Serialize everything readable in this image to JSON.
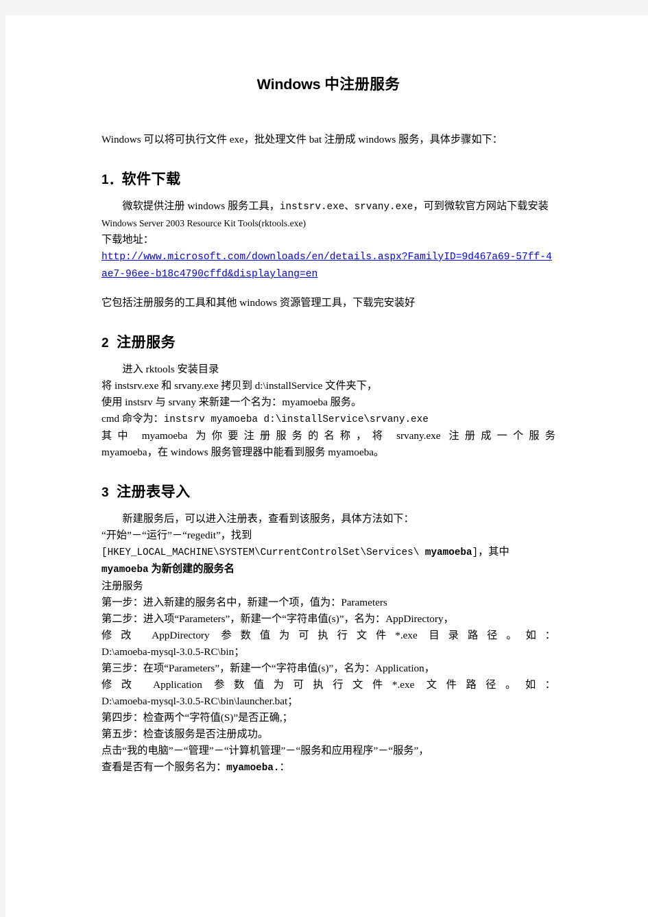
{
  "document": {
    "title_latin": "Windows",
    "title_cjk": " 中注册服务",
    "intro": "Windows 可以将可执行文件 exe，批处理文件 bat 注册成 windows 服务，具体步骤如下："
  },
  "section1": {
    "number": "1．",
    "heading": "软件下载",
    "para1_a": "微软提供注册 windows 服务工具，",
    "para1_mono": "instsrv.exe、srvany.exe",
    "para1_b": "，可到微软官方网站下载安装 ",
    "para1_small": "Windows Server 2003 Resource Kit Tools(rktools.exe)",
    "download_label": "下载地址：",
    "url": "http://www.microsoft.com/downloads/en/details.aspx?FamilyID=9d467a69-57ff-4ae7-96ee-b18c4790cffd&displaylang=en",
    "para2": "它包括注册服务的工具和其他 windows 资源管理工具，下载完安装好"
  },
  "section2": {
    "number": "2",
    "heading": "注册服务",
    "line1": "进入 rktools 安装目录",
    "line2": "将 instsrv.exe 和 srvany.exe 拷贝到 d:\\installService 文件夹下，",
    "line3": "使用 instsrv 与 srvany 来新建一个名为：myamoeba 服务。",
    "line4_a": "cmd 命令为：",
    "line4_mono": "instsrv myamoeba d:\\installService\\srvany.exe",
    "line5": "其中 myamoeba 为你要注册服务的名称，将 srvany.exe 注册成一个服务",
    "line6": "myamoeba，在 windows 服务管理器中能看到服务 myamoeba。"
  },
  "section3": {
    "number": "3",
    "heading": "注册表导入",
    "line1": "新建服务后，可以进入注册表，查看到该服务，具体方法如下：",
    "line2": "“开始”－“运行”－“regedit”，找到",
    "line3_mono": "[HKEY_LOCAL_MACHINE\\SYSTEM\\CurrentControlSet\\Services\\ ",
    "line3_bold": "myamoeba",
    "line3_tail_mono": "]",
    "line3_tail": "，其中",
    "line4_bold": "myamoeba",
    "line4_tail": " 为新创建的服务名",
    "line5": "注册服务",
    "step1": "第一步：进入新建的服务名中，新建一个项，值为：Parameters",
    "step2": "第二步：进入项“Parameters”，新建一个“字符串值(s)”，名为：AppDirectory，",
    "step2_wide": "修改 AppDirectory 参数值为可执行文件*.exe 目录路径。如：",
    "step2_path": "D:\\amoeba-mysql-3.0.5-RC\\bin；",
    "step3": "第三步：在项“Parameters”，新建一个“字符串值(s)”，名为：Application，",
    "step3_wide": "修改 Application 参数值为可执行文件*.exe 文件路径。如：",
    "step3_path": "D:\\amoeba-mysql-3.0.5-RC\\bin\\launcher.bat；",
    "step4": "第四步：检查两个“字符值(S)”是否正确,；",
    "step5": "第五步：检查该服务是否注册成功。",
    "line_click": "点击“我的电脑”－“管理”－“计算机管理”－“服务和应用程序”－“服务”，",
    "line_check_a": "查看是否有一个服务名为：",
    "line_check_bold": "myamoeba.",
    "line_check_tail": "："
  }
}
